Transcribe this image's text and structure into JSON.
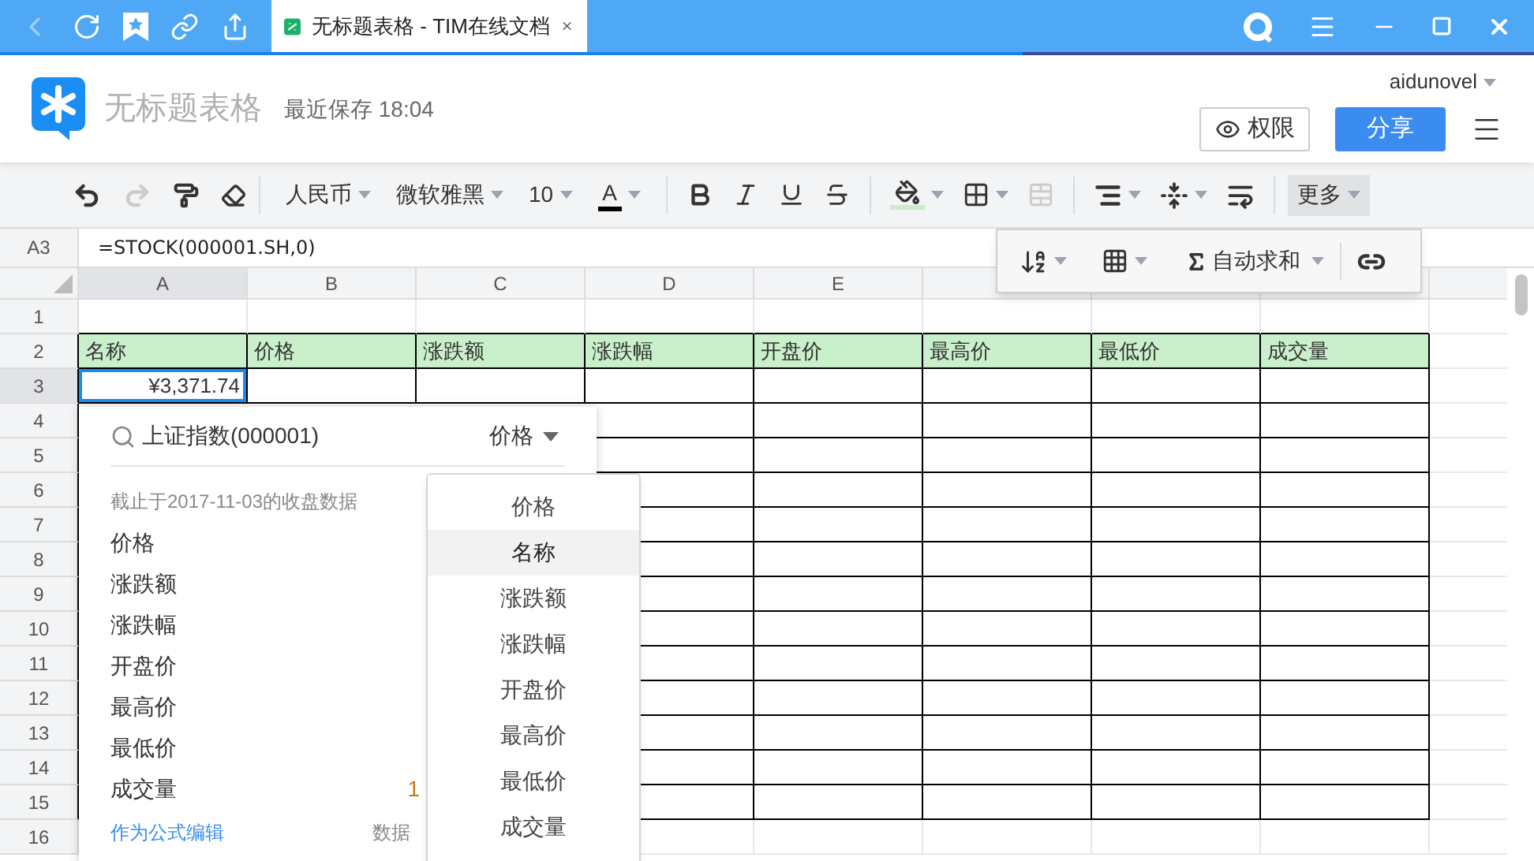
{
  "tab": {
    "title": "无标题表格 - TIM在线文档"
  },
  "header": {
    "doc_title": "无标题表格",
    "save_status": "最近保存",
    "save_time": "18:04",
    "user": "aidunovel",
    "permission_button": "权限",
    "share_button": "分享"
  },
  "toolbar": {
    "format": "人民币",
    "font": "微软雅黑",
    "size": "10",
    "font_color_label": "A",
    "more": "更多"
  },
  "more_menu": {
    "autosum": "自动求和"
  },
  "formula_bar": {
    "cell_ref": "A3",
    "formula": "=STOCK(000001.SH,0)"
  },
  "sheet": {
    "columns": [
      {
        "label": "A",
        "selected": true
      },
      {
        "label": "B",
        "selected": false
      },
      {
        "label": "C",
        "selected": false
      },
      {
        "label": "D",
        "selected": false
      },
      {
        "label": "E",
        "selected": false
      }
    ],
    "rows": [
      {
        "label": "1",
        "selected": false,
        "kind": "blank"
      },
      {
        "label": "2",
        "selected": false,
        "kind": "header",
        "cells": [
          {
            "text": "名称",
            "selected": false
          },
          {
            "text": "价格",
            "selected": false
          },
          {
            "text": "涨跌额",
            "selected": false
          },
          {
            "text": "涨跌幅",
            "selected": false
          },
          {
            "text": "开盘价",
            "selected": false
          },
          {
            "text": "最高价",
            "selected": false
          },
          {
            "text": "最低价",
            "selected": false
          },
          {
            "text": "成交量",
            "selected": false
          }
        ]
      },
      {
        "label": "3",
        "selected": true,
        "kind": "table",
        "cells": [
          {
            "text": "¥3,371.74",
            "selected": true
          }
        ]
      },
      {
        "label": "4",
        "selected": false,
        "kind": "table"
      },
      {
        "label": "5",
        "selected": false,
        "kind": "table"
      },
      {
        "label": "6",
        "selected": false,
        "kind": "table"
      },
      {
        "label": "7",
        "selected": false,
        "kind": "table"
      },
      {
        "label": "8",
        "selected": false,
        "kind": "table"
      },
      {
        "label": "9",
        "selected": false,
        "kind": "table"
      },
      {
        "label": "10",
        "selected": false,
        "kind": "table"
      },
      {
        "label": "11",
        "selected": false,
        "kind": "table"
      },
      {
        "label": "12",
        "selected": false,
        "kind": "table"
      },
      {
        "label": "13",
        "selected": false,
        "kind": "table"
      },
      {
        "label": "14",
        "selected": false,
        "kind": "table"
      },
      {
        "label": "15",
        "selected": false,
        "kind": "table"
      },
      {
        "label": "16",
        "selected": false,
        "kind": "blank"
      }
    ]
  },
  "stock_panel": {
    "query": "上证指数(000001)",
    "field": "价格",
    "note": "截止于2017-11-03的收盘数据",
    "fields": [
      {
        "label": "价格"
      },
      {
        "label": "涨跌额"
      },
      {
        "label": "涨跌幅"
      },
      {
        "label": "开盘价"
      },
      {
        "label": "最高价"
      },
      {
        "label": "最低价"
      },
      {
        "label": "成交量",
        "value": "1"
      }
    ],
    "edit_link": "作为公式编辑",
    "source": "数据"
  },
  "field_dropdown": {
    "options": [
      {
        "label": "价格",
        "selected": false
      },
      {
        "label": "名称",
        "selected": true
      },
      {
        "label": "涨跌额",
        "selected": false
      },
      {
        "label": "涨跌幅",
        "selected": false
      },
      {
        "label": "开盘价",
        "selected": false
      },
      {
        "label": "最高价",
        "selected": false
      },
      {
        "label": "最低价",
        "selected": false
      },
      {
        "label": "成交量",
        "selected": false
      }
    ]
  }
}
